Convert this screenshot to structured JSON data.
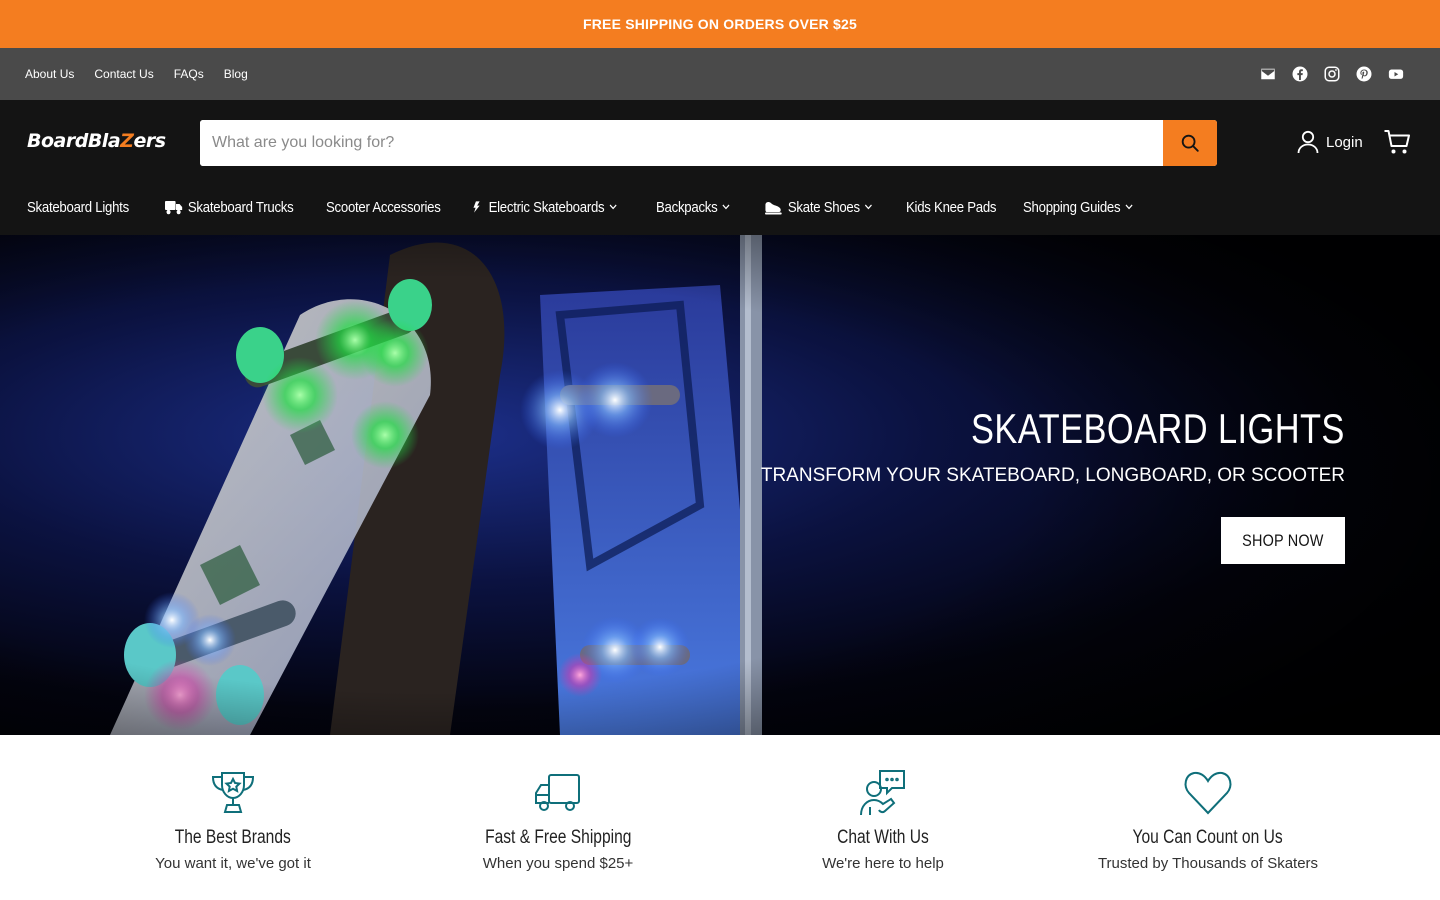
{
  "announcement": {
    "text": "FREE SHIPPING ON ORDERS OVER $25"
  },
  "utility": {
    "links": [
      "About Us",
      "Contact Us",
      "FAQs",
      "Blog"
    ],
    "social": [
      "email-icon",
      "facebook-icon",
      "instagram-icon",
      "pinterest-icon",
      "youtube-icon"
    ]
  },
  "header": {
    "logo_text": "BoardBlaZers",
    "search": {
      "placeholder": "What are you looking for?",
      "value": ""
    },
    "login_label": "Login"
  },
  "nav": {
    "items": [
      {
        "label": "Skateboard Lights",
        "icon": "",
        "dropdown": false
      },
      {
        "label": "Skateboard Trucks",
        "icon": "truck-icon",
        "dropdown": false
      },
      {
        "label": "Scooter Accessories",
        "icon": "",
        "dropdown": false
      },
      {
        "label": "Electric Skateboards",
        "icon": "lightning-icon",
        "dropdown": true
      },
      {
        "label": "Backpacks",
        "icon": "",
        "dropdown": true
      },
      {
        "label": "Skate Shoes",
        "icon": "shoe-icon",
        "dropdown": true
      },
      {
        "label": "Kids Knee Pads",
        "icon": "",
        "dropdown": false
      },
      {
        "label": "Shopping Guides",
        "icon": "",
        "dropdown": true
      }
    ]
  },
  "hero": {
    "title": "SKATEBOARD LIGHTS",
    "subtitle": "TRANSFORM YOUR SKATEBOARD, LONGBOARD, OR SCOOTER",
    "button_label": "SHOP NOW"
  },
  "features": [
    {
      "icon": "trophy-icon",
      "title": "The Best Brands",
      "subtitle": "You want it, we've got it"
    },
    {
      "icon": "delivery-truck-icon",
      "title": "Fast & Free Shipping",
      "subtitle": "When you spend $25+"
    },
    {
      "icon": "chat-support-icon",
      "title": "Chat With Us",
      "subtitle": "We're here to help"
    },
    {
      "icon": "heart-icon",
      "title": "You Can Count on Us",
      "subtitle": "Trusted by Thousands of Skaters"
    }
  ],
  "colors": {
    "accent": "#f47d20",
    "utility_bar": "#4a4a4a",
    "header": "#141414",
    "feature_icon": "#0f6f7a"
  }
}
